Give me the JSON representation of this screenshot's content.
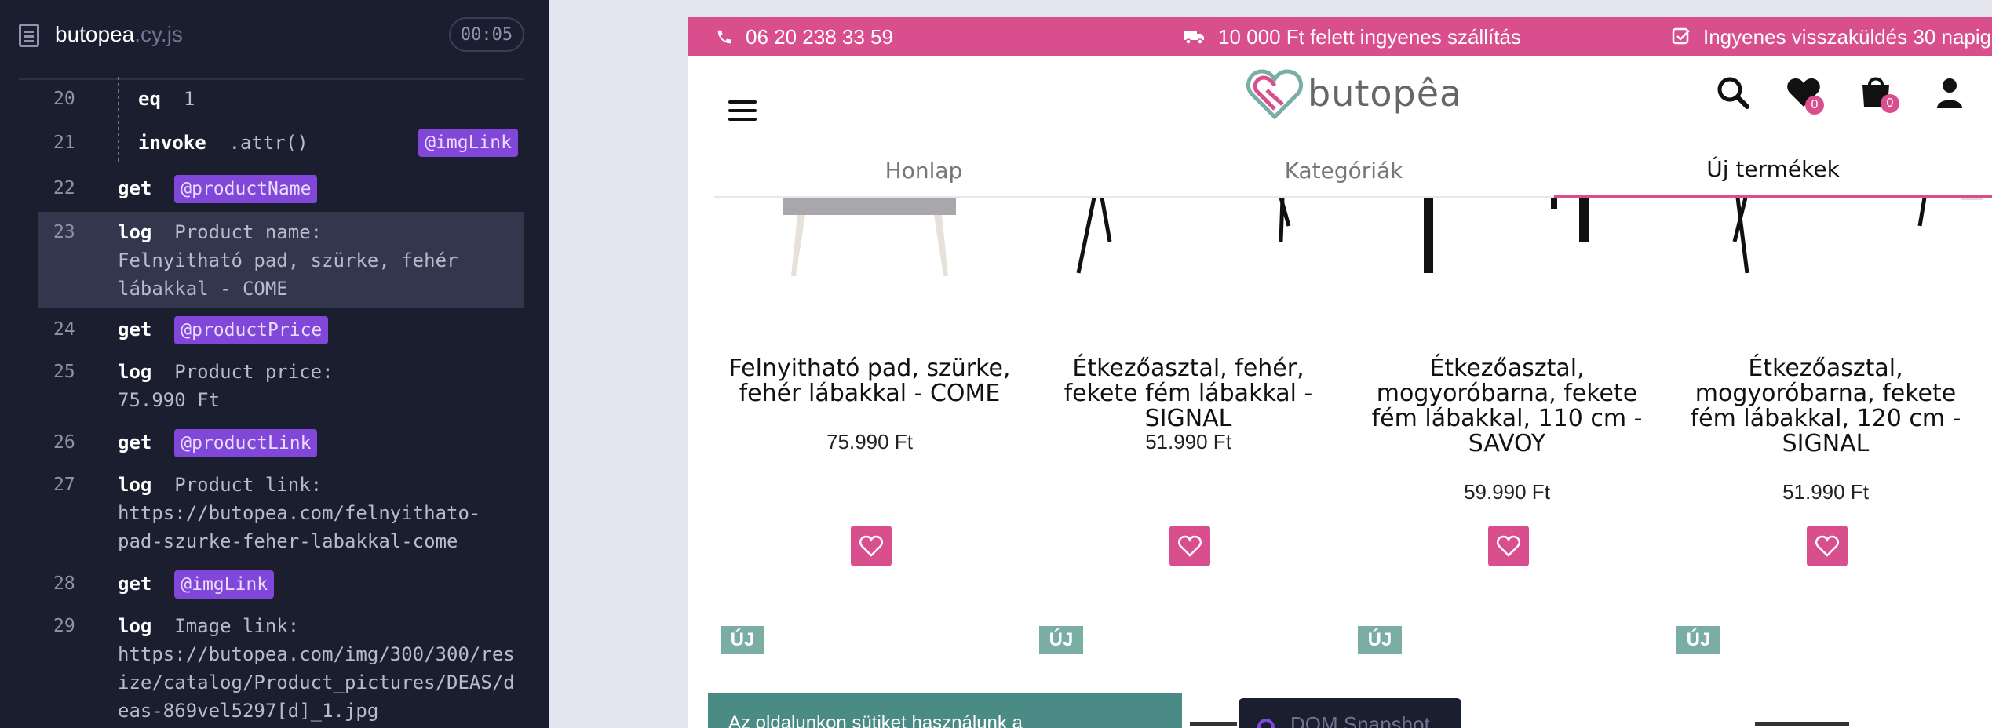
{
  "runner": {
    "spec_name": "butopea",
    "spec_ext": ".cy.js",
    "timer": "00:05",
    "commands": [
      {
        "num": "20",
        "name": "eq",
        "message": "1"
      },
      {
        "num": "21",
        "name": "invoke",
        "message": ".attr()",
        "alias": "@imgLink"
      },
      {
        "num": "22",
        "name": "get",
        "alias": "@productName"
      },
      {
        "num": "23",
        "name": "log",
        "message": "Product name:\nFelnyitható pad, szürke, fehér\nlábakkal - COME"
      },
      {
        "num": "24",
        "name": "get",
        "alias": "@productPrice"
      },
      {
        "num": "25",
        "name": "log",
        "message": "Product price:\n75.990 Ft"
      },
      {
        "num": "26",
        "name": "get",
        "alias": "@productLink"
      },
      {
        "num": "27",
        "name": "log",
        "message": "Product link:\nhttps://butopea.com/felnyithato-\npad-szurke-feher-labakkal-come"
      },
      {
        "num": "28",
        "name": "get",
        "alias": "@imgLink"
      },
      {
        "num": "29",
        "name": "log",
        "message": "Image link:\nhttps://butopea.com/img/300/300/res\nize/catalog/Product_pictures/DEAS/d\neas-869vel5297[d]_1.jpg"
      }
    ]
  },
  "site": {
    "topbar": {
      "phone": "06 20 238 33 59",
      "shipping": "10 000 Ft felett ingyenes szállítás",
      "returns": "Ingyenes visszaküldés 30 napig"
    },
    "logo_text": "butopêa",
    "wishlist_count": "0",
    "cart_count": "0",
    "nav": {
      "home": "Honlap",
      "categories": "Kategóriák",
      "new_products": "Új termékek"
    },
    "products": [
      {
        "title": "Felnyitható pad, szürke, fehér lábakkal - COME",
        "price": "75.990 Ft"
      },
      {
        "title": "Étkezőasztal, fehér, fekete fém lábakkal - SIGNAL",
        "price": "51.990 Ft"
      },
      {
        "title": "Étkezőasztal, mogyoróbarna, fekete fém lábakkal, 110 cm - SAVOY",
        "price": "59.990 Ft"
      },
      {
        "title": "Étkezőasztal, mogyoróbarna, fekete fém lábakkal, 120 cm - SIGNAL",
        "price": "51.990 Ft"
      }
    ],
    "new_badge": "ÚJ",
    "cookie_text": "Az oldalunkon sütiket használunk a",
    "dom_snapshot": "DOM Snapshot"
  },
  "colors": {
    "brand_pink": "#d94f8e",
    "new_badge": "#7aaea5",
    "alias_purple": "#8047d8",
    "runner_bg": "#1b1e2e"
  },
  "icons": [
    "file-icon",
    "phone-icon",
    "truck-icon",
    "check-square-icon",
    "menu-icon",
    "search-icon",
    "heart-icon",
    "shopping-bag-icon",
    "user-icon"
  ]
}
